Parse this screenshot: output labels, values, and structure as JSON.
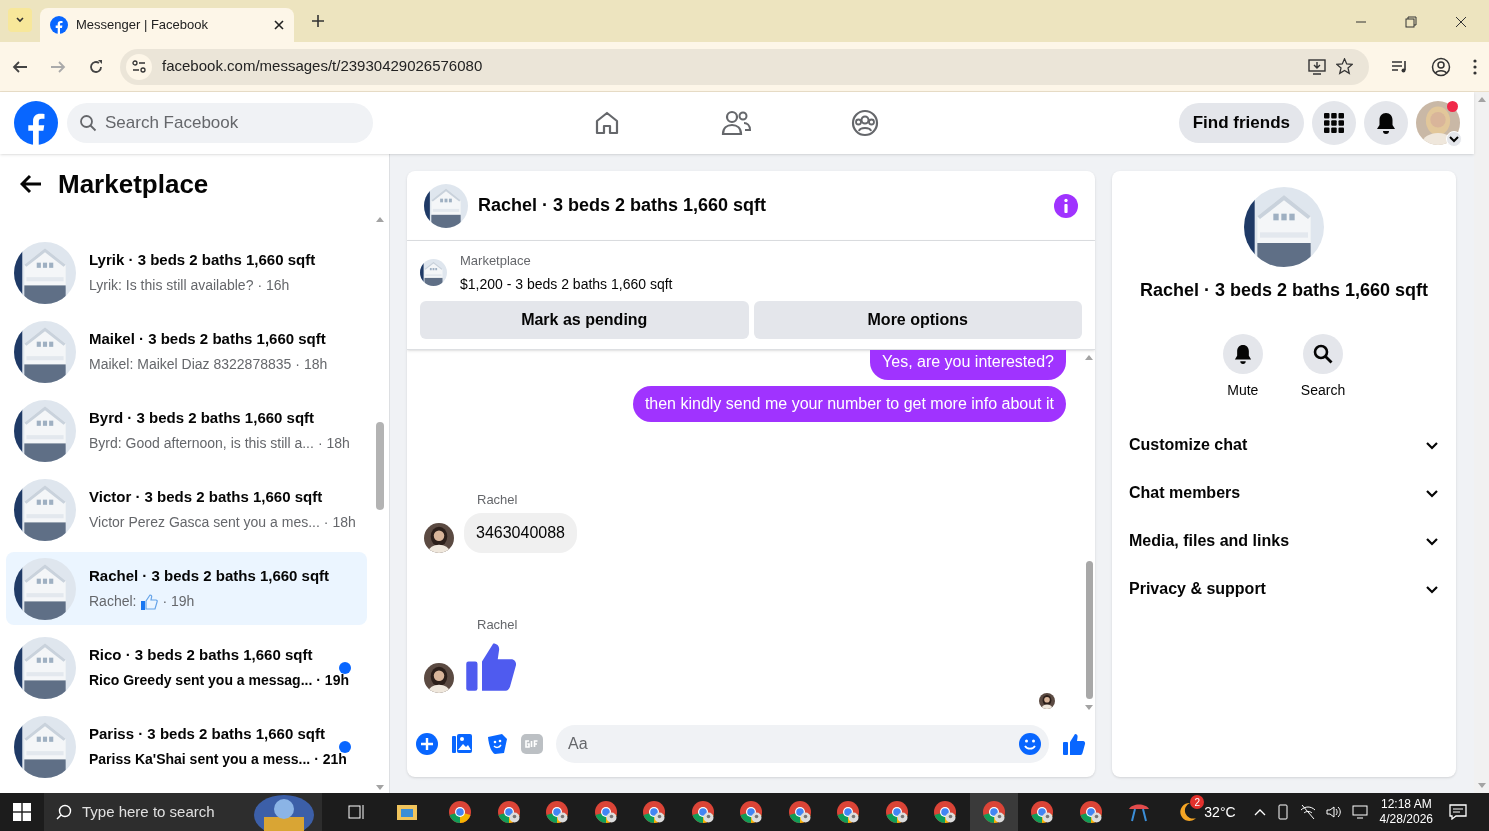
{
  "browser": {
    "tab_title": "Messenger | Facebook",
    "url": "facebook.com/messages/t/23930429026576080"
  },
  "header": {
    "search_placeholder": "Search Facebook",
    "find_friends": "Find friends",
    "notification_dot": true
  },
  "sidebar": {
    "title": "Marketplace",
    "conversations": [
      {
        "title": "Lyrik · 3 beds 2 baths 1,660 sqft",
        "preview": "Lyrik: Is this still available?",
        "time": "· 16h",
        "selected": false,
        "unread": false
      },
      {
        "title": "Maikel · 3 beds 2 baths 1,660 sqft",
        "preview": "Maikel: Maikel Diaz 8322878835",
        "time": "· 18h",
        "selected": false,
        "unread": false
      },
      {
        "title": "Byrd · 3 beds 2 baths 1,660 sqft",
        "preview": "Byrd: Good afternoon, is this still a...",
        "time": "· 18h",
        "selected": false,
        "unread": false
      },
      {
        "title": "Victor · 3 beds 2 baths 1,660 sqft",
        "preview": "Victor Perez Gasca sent you a mes...",
        "time": "· 18h",
        "selected": false,
        "unread": false
      },
      {
        "title": "Rachel · 3 beds 2 baths 1,660 sqft",
        "preview": "Rachel:",
        "preview_like": true,
        "time": "· 19h",
        "selected": true,
        "unread": false
      },
      {
        "title": "Rico · 3 beds 2 baths 1,660 sqft",
        "preview": "Rico Greedy sent you a messag...",
        "time": "· 19h",
        "selected": false,
        "unread": true
      },
      {
        "title": "Pariss · 3 beds 2 baths 1,660 sqft",
        "preview": "Pariss Ka'Shai sent you a mess...",
        "time": "· 21h",
        "selected": false,
        "unread": true
      }
    ]
  },
  "chat": {
    "title": "Rachel · 3 beds 2 baths 1,660 sqft",
    "listing": {
      "source": "Marketplace",
      "summary": "$1,200 - 3 beds 2 baths 1,660 sqft"
    },
    "actions": [
      "Mark as pending",
      "More options"
    ],
    "messages": [
      {
        "kind": "outgoing",
        "text": "Yes, are you interested?"
      },
      {
        "kind": "outgoing",
        "text": "then kindly send me your number to get more info about it"
      },
      {
        "kind": "incoming",
        "sender": "Rachel",
        "text": "3463040088"
      },
      {
        "kind": "like",
        "sender": "Rachel"
      }
    ],
    "composer_placeholder": "Aa"
  },
  "details": {
    "title": "Rachel · 3 beds 2 baths 1,660 sqft",
    "actions": [
      "Mute",
      "Search"
    ],
    "sections": [
      {
        "label": "Customize chat",
        "expanded": false
      },
      {
        "label": "Chat members",
        "expanded": false
      },
      {
        "label": "Media, files and links",
        "expanded": false
      },
      {
        "label": "Privacy & support",
        "expanded": false
      }
    ]
  },
  "taskbar": {
    "search_placeholder": "Type here to search",
    "weather_badge": "2",
    "temperature": "32°C",
    "time": "12:18 AM",
    "date": "4/28/2026"
  }
}
